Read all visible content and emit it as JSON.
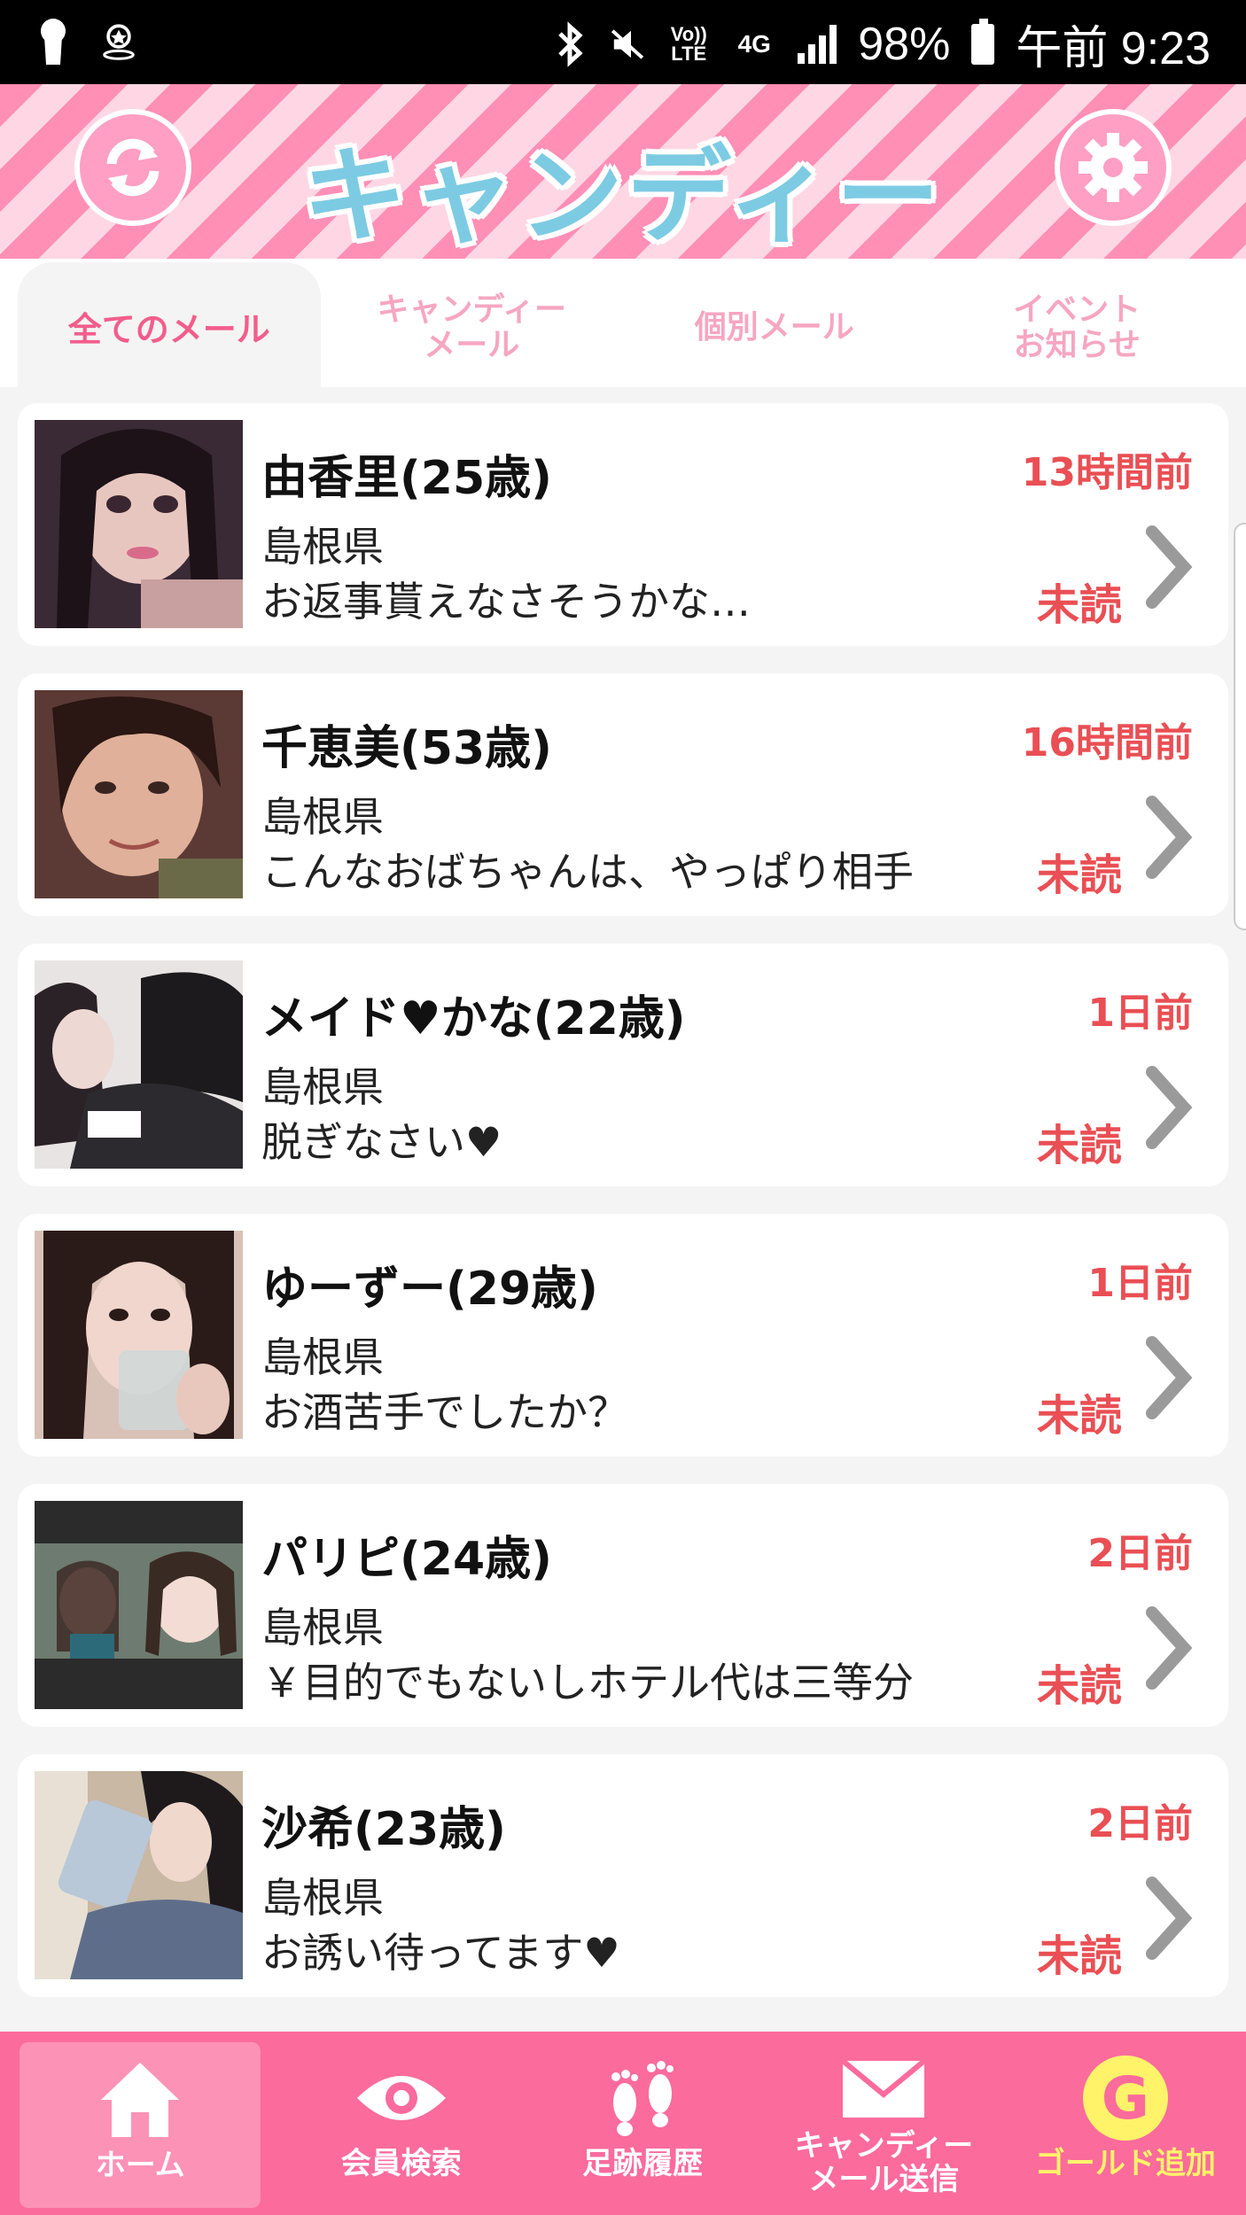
{
  "status_bar": {
    "battery": "98%",
    "time": "午前 9:23",
    "network": "4G",
    "lte": "Vo)) LTE"
  },
  "header": {
    "title": "キャンディー",
    "refresh_icon": "refresh-icon",
    "settings_icon": "gear-icon"
  },
  "tabs": [
    {
      "label": "全てのメール",
      "active": true
    },
    {
      "label": "キャンディー\nメール",
      "active": false
    },
    {
      "label": "個別メール",
      "active": false
    },
    {
      "label": "イベント\nお知らせ",
      "active": false
    }
  ],
  "messages": [
    {
      "name": "由香里(25歳)",
      "prefecture": "島根県",
      "preview": "お返事貰えなさそうかな…",
      "time": "13時間前",
      "status": "未読"
    },
    {
      "name": "千恵美(53歳)",
      "prefecture": "島根県",
      "preview": "こんなおばちゃんは、やっぱり相手",
      "time": "16時間前",
      "status": "未読"
    },
    {
      "name": "メイド♥かな(22歳)",
      "prefecture": "島根県",
      "preview": "脱ぎなさい♥",
      "time": "1日前",
      "status": "未読"
    },
    {
      "name": "ゆーずー(29歳)",
      "prefecture": "島根県",
      "preview": "お酒苦手でしたか？",
      "time": "1日前",
      "status": "未読"
    },
    {
      "name": "パリピ(24歳)",
      "prefecture": "島根県",
      "preview": "￥目的でもないしホテル代は三等分",
      "time": "2日前",
      "status": "未読"
    },
    {
      "name": "沙希(23歳)",
      "prefecture": "島根県",
      "preview": "お誘い待ってます♥",
      "time": "2日前",
      "status": "未読"
    }
  ],
  "nav": [
    {
      "label": "ホーム",
      "icon": "home-icon"
    },
    {
      "label": "会員検索",
      "icon": "eye-icon"
    },
    {
      "label": "足跡履歴",
      "icon": "footprints-icon"
    },
    {
      "label": "キャンディー\nメール送信",
      "icon": "mail-icon"
    },
    {
      "label": "ゴールド追加",
      "icon": "gold-coin-icon",
      "glyph": "G"
    }
  ],
  "colors": {
    "accent_pink": "#fb6b9c",
    "alert_red": "#e94f54",
    "logo_blue": "#7ccbe3",
    "gold": "#fff36a"
  }
}
